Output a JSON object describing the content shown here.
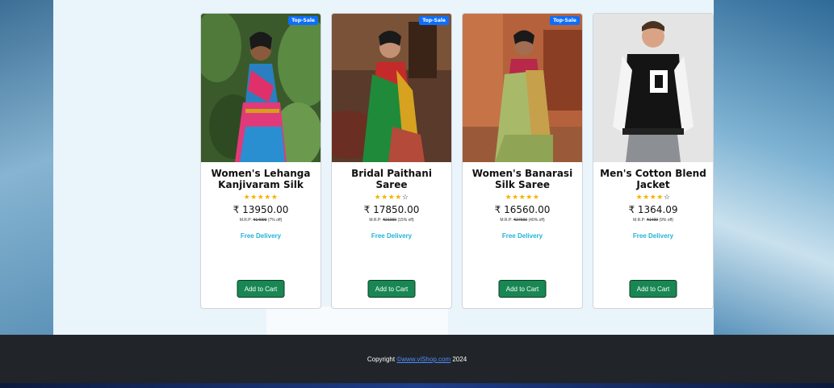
{
  "products": [
    {
      "title": "Women's Lehanga Kanjivaram Silk",
      "badge": "Top-Sale",
      "stars_full": "★★★★★",
      "stars_empty": "",
      "rating": 5,
      "price": "₹ 13950.00",
      "mrp_label": "M.R.P:",
      "mrp": "₹14999",
      "discount": "(7% off)",
      "delivery": "Free Delivery",
      "button": "Add to Cart",
      "image_icon": "model-pink-saree-image"
    },
    {
      "title": "Bridal Paithani Saree",
      "badge": "Top-Sale",
      "stars_full": "★★★★",
      "stars_empty": "☆",
      "rating": 4,
      "price": "₹ 17850.00",
      "mrp_label": "M.R.P:",
      "mrp": "₹21000",
      "discount": "(15% off)",
      "delivery": "Free Delivery",
      "button": "Add to Cart",
      "image_icon": "model-green-saree-image"
    },
    {
      "title": "Women's Banarasi Silk Saree",
      "badge": "Top-Sale",
      "stars_full": "★★★★★",
      "stars_empty": "",
      "rating": 5,
      "price": "₹ 16560.00",
      "mrp_label": "M.R.P:",
      "mrp": "₹27600",
      "discount": "(40% off)",
      "delivery": "Free Delivery",
      "button": "Add to Cart",
      "image_icon": "model-olive-saree-image"
    },
    {
      "title": "Men's Cotton Blend Jacket",
      "badge": "",
      "stars_full": "★★★★",
      "stars_empty": "☆",
      "rating": 4,
      "price": "₹ 1364.09",
      "mrp_label": "M.R.P:",
      "mrp": "₹1499",
      "discount": "(9% off)",
      "delivery": "Free Delivery",
      "button": "Add to Cart",
      "image_icon": "model-varsity-jacket-image"
    }
  ],
  "footer": {
    "prefix": "Copyright ",
    "link": "©www.viShop.com",
    "suffix": " 2024"
  },
  "colors": {
    "button_bg": "#198754",
    "badge_bg": "#0d6efd",
    "star": "#f5b301",
    "delivery": "#22b3d6",
    "footer_bg": "#212529"
  }
}
